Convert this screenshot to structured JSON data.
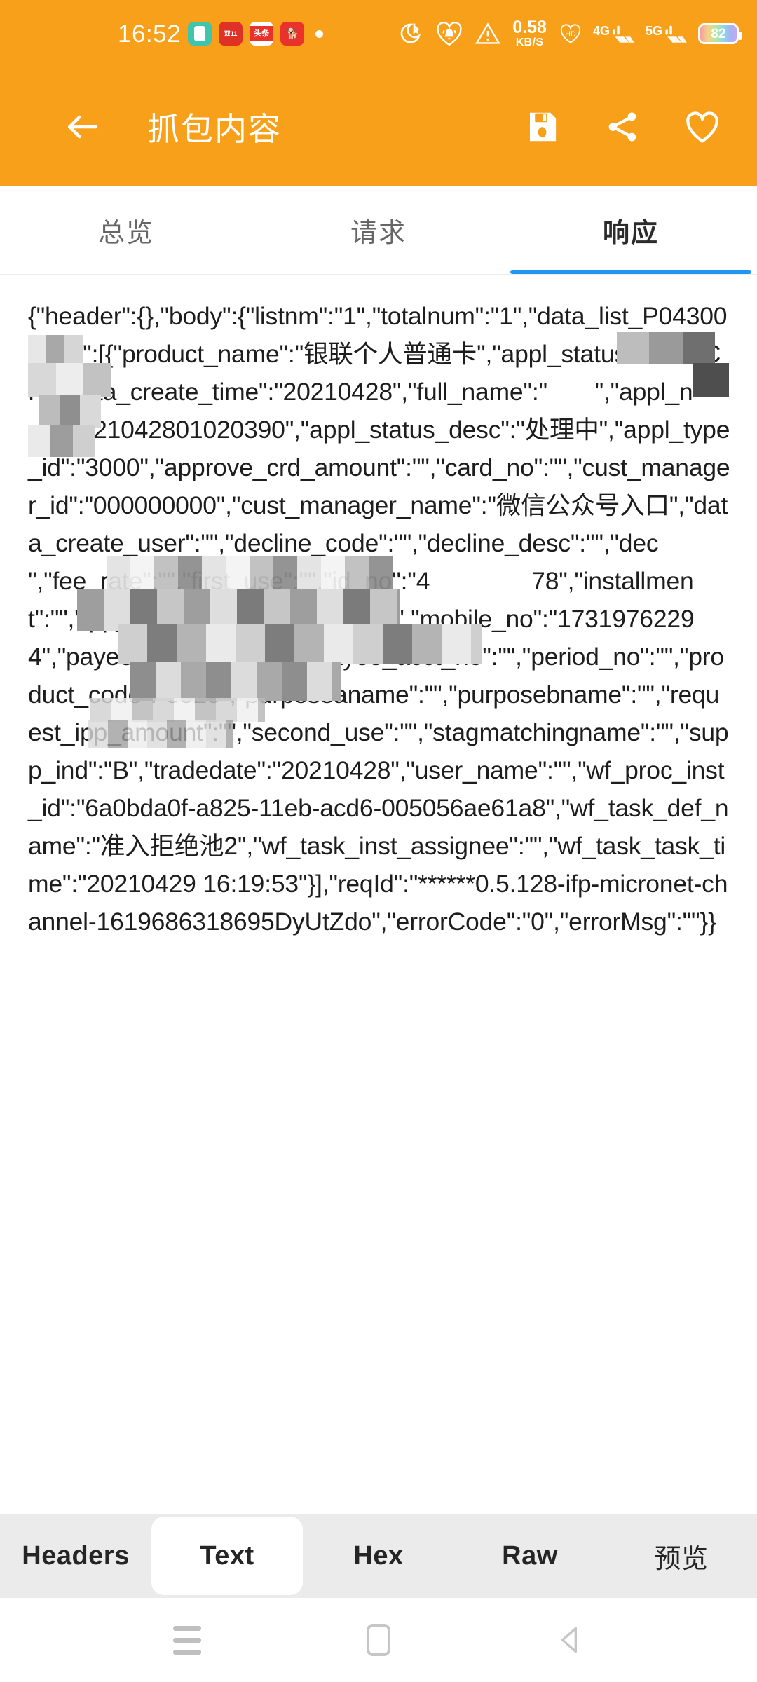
{
  "status_bar": {
    "clock": "16:52",
    "app_icons": [
      "notes-app-icon",
      "red-app-icon",
      "toutiao-app-icon",
      "dog-app-icon"
    ],
    "toutiao_label": "头条",
    "red_label": "双11",
    "dot_indicator": "•",
    "icons": [
      "bluetooth-moon-icon",
      "heart-bell-icon",
      "warning-triangle-icon",
      "hd-heart-icon"
    ],
    "net_speed_value": "0.58",
    "net_speed_unit": "KB/S",
    "signal_1_label": "4G",
    "signal_2_label": "5G",
    "battery_percent": "82"
  },
  "app_bar": {
    "back_icon": "back-arrow-icon",
    "title": "抓包内容",
    "actions": [
      {
        "name": "save-icon",
        "label": "保存"
      },
      {
        "name": "share-icon",
        "label": "分享"
      },
      {
        "name": "favorite-heart-icon",
        "label": "收藏"
      }
    ],
    "background_color": "#F9A01B"
  },
  "top_tabs": {
    "active_index": 2,
    "indicator_color": "#2196F3",
    "items": [
      {
        "label": "总览"
      },
      {
        "label": "请求"
      },
      {
        "label": "响应"
      }
    ]
  },
  "response_body": {
    "text": "{\"header\":{},\"body\":{\"listnm\":\"1\",\"totalnum\":\"1\",\"data_list_P043000704\":[{\"product_name\":\"银联个人普通卡\",\"appl_status\":\"CHECK\",\"data_create_time\":\"20210428\",\"full_name\":\"       \",\"appl_no\":\"2021042801020390\",\"appl_status_desc\":\"处理中\",\"appl_type_id\":\"3000\",\"approve_crd_amount\":\"\",\"card_no\":\"\",\"cust_manager_id\":\"000000000\",\"cust_manager_name\":\"微信公众号入口\",\"data_create_user\":\"\",\"decline_code\":\"\",\"decline_desc\":\"\",\"dec                \",\"fee_rate\":\"\",\"first_use\":\"\",\"id_no\":\"4               78\",\"installment\":\"\",\"ipp_config_code\":\"       0.000\",\"mobile_no\":\"17319762294\",\"payee_acct_name\":\"\",\"payee_acct_no\":\"\",\"period_no\":\"\",\"product_code\":\"0020\",\"purposeaname\":\"\",\"purposebname\":\"\",\"request_ipp_amount\":\"\",\"second_use\":\"\",\"stagmatchingname\":\"\",\"supp_ind\":\"B\",\"tradedate\":\"20210428\",\"user_name\":\"\",\"wf_proc_inst_id\":\"6a0bda0f-a825-11eb-acd6-005056ae61a8\",\"wf_task_def_name\":\"准入拒绝池2\",\"wf_task_inst_assignee\":\"\",\"wf_task_task_time\":\"20210429 16:19:53\"}],\"reqId\":\"******0.5.128-ifp-micronet-channel-1619686318695DyUtZdo\",\"errorCode\":\"0\",\"errorMsg\":\"\"}}"
  },
  "bottom_tabs": {
    "selected_index": 1,
    "items": [
      {
        "label": "Headers"
      },
      {
        "label": "Text"
      },
      {
        "label": "Hex"
      },
      {
        "label": "Raw"
      },
      {
        "label": "预览"
      }
    ]
  },
  "nav_bar": {
    "items": [
      {
        "name": "recents-menu-icon"
      },
      {
        "name": "home-icon"
      },
      {
        "name": "back-nav-icon"
      }
    ]
  }
}
